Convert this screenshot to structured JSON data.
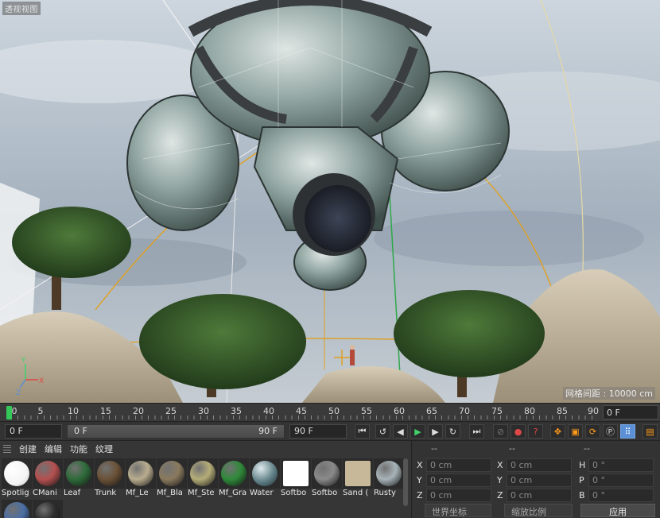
{
  "viewport": {
    "title": "透视视图",
    "grid_spacing": "网格间距 : 10000 cm"
  },
  "timeline": {
    "ticks": [
      "0",
      "5",
      "10",
      "15",
      "20",
      "25",
      "30",
      "35",
      "40",
      "45",
      "50",
      "55",
      "60",
      "65",
      "70",
      "75",
      "80",
      "85",
      "90"
    ],
    "current_frame": "0 F"
  },
  "transport": {
    "start_field": "0 F",
    "range_start": "0 F",
    "range_end": "90 F",
    "end_field": "90 F",
    "buttons": {
      "to_start": "⏮",
      "prev_key": "◀︎",
      "prev_frame": "◀",
      "play": "▶",
      "next_frame": "▶",
      "next_key": "▶︎",
      "to_end": "⏭"
    }
  },
  "materials": {
    "menu": [
      "创建",
      "编辑",
      "功能",
      "纹理"
    ],
    "items": [
      {
        "name": "Spotlig",
        "color": "#f4f4f4",
        "kind": "white"
      },
      {
        "name": "CMani",
        "color": "#b55050",
        "kind": "pattern"
      },
      {
        "name": "Leaf",
        "color": "#2f6b3a",
        "kind": "solid"
      },
      {
        "name": "Trunk",
        "color": "#6b5238",
        "kind": "solid"
      },
      {
        "name": "Mf_Le",
        "color": "#b9ad8f",
        "kind": "solid"
      },
      {
        "name": "Mf_Bla",
        "color": "#8a7a5e",
        "kind": "solid"
      },
      {
        "name": "Mf_Ste",
        "color": "#b5ad78",
        "kind": "solid"
      },
      {
        "name": "Mf_Gra",
        "color": "#2f8a3a",
        "kind": "solid"
      },
      {
        "name": "Water",
        "color": "#5f7f86",
        "kind": "glass"
      },
      {
        "name": "Softbo",
        "color": "#ffffff",
        "kind": "square"
      },
      {
        "name": "Softbo",
        "color": "#8a8a8a",
        "kind": "solid"
      },
      {
        "name": "Sand (",
        "color": "#c8b89a",
        "kind": "square"
      },
      {
        "name": "Rusty",
        "color": "#a7b3b8",
        "kind": "solid"
      },
      {
        "name": "",
        "color": "#4a6ea5",
        "kind": "solid"
      },
      {
        "name": "",
        "color": "#2d2d2d",
        "kind": "solid"
      }
    ]
  },
  "attributes": {
    "header": [
      "--",
      "--",
      "--"
    ],
    "rows": [
      {
        "l1": "X",
        "v1": "0 cm",
        "l2": "X",
        "v2": "0 cm",
        "l3": "H",
        "v3": "0 °"
      },
      {
        "l1": "Y",
        "v1": "0 cm",
        "l2": "Y",
        "v2": "0 cm",
        "l3": "P",
        "v3": "0 °"
      },
      {
        "l1": "Z",
        "v1": "0 cm",
        "l2": "Z",
        "v2": "0 cm",
        "l3": "B",
        "v3": "0 °"
      }
    ],
    "coord_mode": "世界坐标",
    "scale_mode": "缩放比例",
    "apply_label": "应用"
  }
}
